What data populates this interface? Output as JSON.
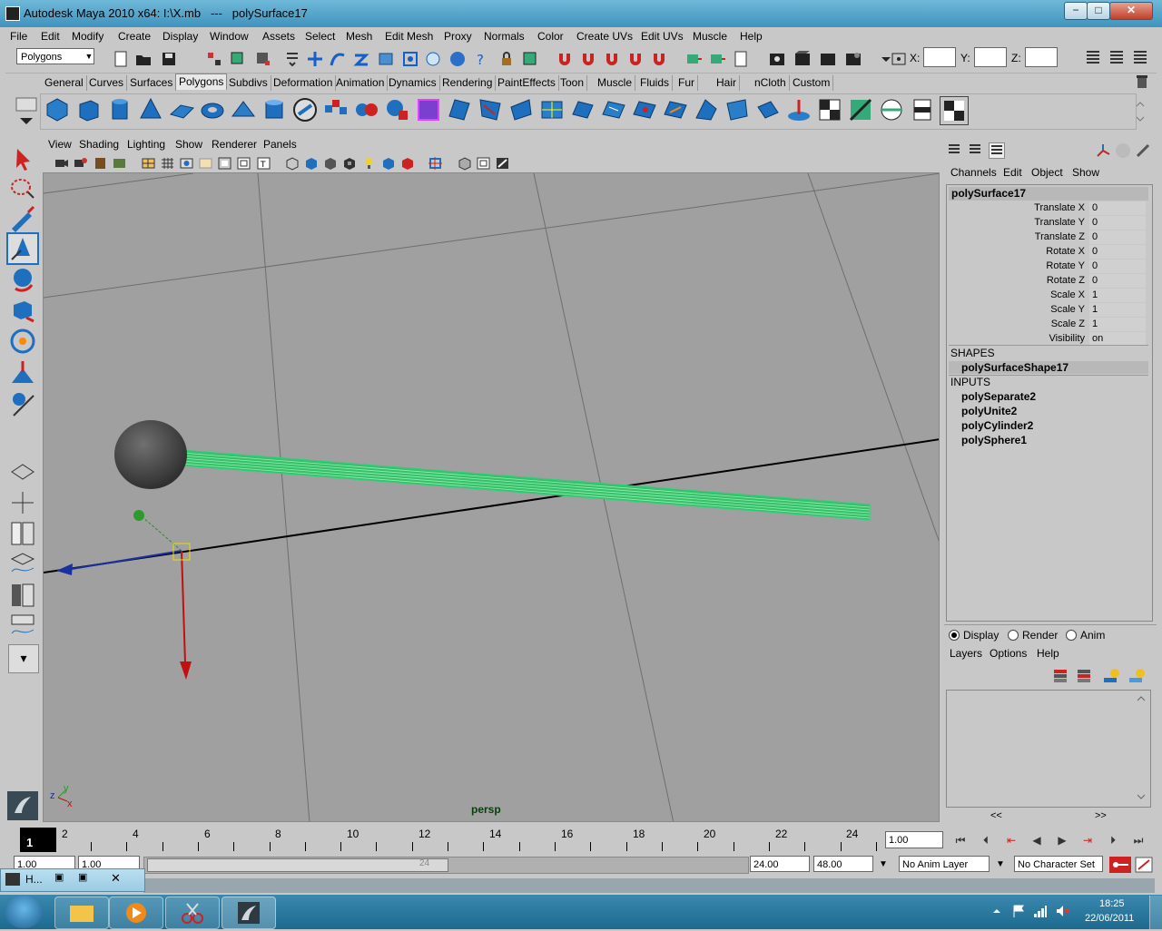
{
  "window": {
    "title": "Autodesk Maya 2010 x64: I:\\X.mb   ---   polySurface17",
    "min": "−",
    "max": "□",
    "close": "✕"
  },
  "menubar": [
    "File",
    "Edit",
    "Modify",
    "Create",
    "Display",
    "Window",
    "Assets",
    "Select",
    "Mesh",
    "Edit Mesh",
    "Proxy",
    "Normals",
    "Color",
    "Create UVs",
    "Edit UVs",
    "Muscle",
    "Help"
  ],
  "statusline": {
    "mode": "Polygons",
    "x_label": "X:",
    "y_label": "Y:",
    "z_label": "Z:"
  },
  "shelf_tabs": [
    "General",
    "Curves",
    "Surfaces",
    "Polygons",
    "Subdivs",
    "Deformation",
    "Animation",
    "Dynamics",
    "Rendering",
    "PaintEffects",
    "Toon",
    "Muscle",
    "Fluids",
    "Fur",
    "Hair",
    "nCloth",
    "Custom"
  ],
  "active_shelf_tab": "Polygons",
  "panel": {
    "menus": [
      "View",
      "Shading",
      "Lighting",
      "Show",
      "Renderer",
      "Panels"
    ],
    "camera_label": "persp",
    "axis_labels": {
      "x": "x",
      "y": "y",
      "z": "z"
    }
  },
  "channel_box": {
    "menus": [
      "Channels",
      "Edit",
      "Object",
      "Show"
    ],
    "object_name": "polySurface17",
    "attributes": [
      {
        "label": "Translate X",
        "value": "0"
      },
      {
        "label": "Translate Y",
        "value": "0"
      },
      {
        "label": "Translate Z",
        "value": "0"
      },
      {
        "label": "Rotate X",
        "value": "0"
      },
      {
        "label": "Rotate Y",
        "value": "0"
      },
      {
        "label": "Rotate Z",
        "value": "0"
      },
      {
        "label": "Scale X",
        "value": "1"
      },
      {
        "label": "Scale Y",
        "value": "1"
      },
      {
        "label": "Scale Z",
        "value": "1"
      },
      {
        "label": "Visibility",
        "value": "on"
      }
    ],
    "shapes_header": "SHAPES",
    "shape_node": "polySurfaceShape17",
    "inputs_header": "INPUTS",
    "inputs": [
      "polySeparate2",
      "polyUnite2",
      "polyCylinder2",
      "polySphere1"
    ]
  },
  "layer_editor": {
    "radios": [
      {
        "label": "Display",
        "selected": true
      },
      {
        "label": "Render",
        "selected": false
      },
      {
        "label": "Anim",
        "selected": false
      }
    ],
    "menus": [
      "Layers",
      "Options",
      "Help"
    ],
    "scroll_left": "<<",
    "scroll_right": ">>"
  },
  "timeline": {
    "current_frame": "1",
    "ticks": [
      "2",
      "4",
      "6",
      "8",
      "10",
      "12",
      "14",
      "16",
      "18",
      "20",
      "22",
      "24"
    ],
    "frame_field": "1.00",
    "range_start": "1.00",
    "range_inner_start": "1.00",
    "range_inner_end": "24.00",
    "range_end": "48.00",
    "slider_label": "24",
    "anim_layer": "No Anim Layer",
    "character_set": "No Character Set"
  },
  "minimized_window": {
    "label": "H..."
  },
  "taskbar": {
    "time": "18:25",
    "date": "22/06/2011"
  }
}
